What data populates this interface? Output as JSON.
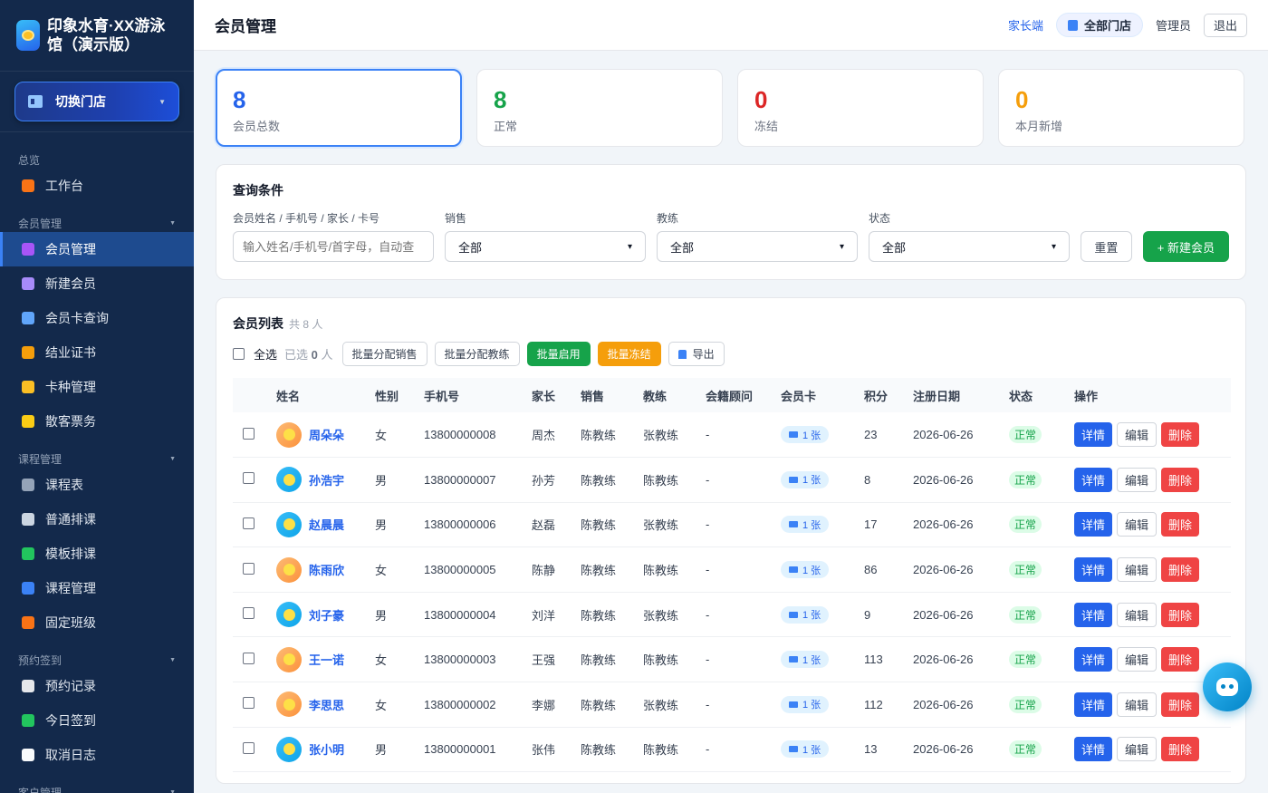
{
  "brand": {
    "title": "印象水育·XX游泳馆（演示版）",
    "logo_icon": "swim-logo-icon"
  },
  "sidebar": {
    "switch_store_label": "切换门店",
    "groups": [
      {
        "label": "总览",
        "items": [
          {
            "label": "工作台",
            "icon": "home-icon",
            "color": "#f97316"
          }
        ]
      },
      {
        "label": "会员管理",
        "items": [
          {
            "label": "会员管理",
            "icon": "users-icon",
            "color": "#a855f7",
            "active": true
          },
          {
            "label": "新建会员",
            "icon": "plus-icon",
            "color": "#a78bfa"
          },
          {
            "label": "会员卡查询",
            "icon": "card-icon",
            "color": "#60a5fa"
          },
          {
            "label": "结业证书",
            "icon": "medal-icon",
            "color": "#f59e0b"
          },
          {
            "label": "卡种管理",
            "icon": "folder-icon",
            "color": "#fbbf24"
          },
          {
            "label": "散客票务",
            "icon": "ticket-icon",
            "color": "#facc15"
          }
        ]
      },
      {
        "label": "课程管理",
        "items": [
          {
            "label": "课程表",
            "icon": "calendar-icon",
            "color": "#94a3b8"
          },
          {
            "label": "普通排课",
            "icon": "calendar-icon",
            "color": "#cbd5e1"
          },
          {
            "label": "模板排课",
            "icon": "template-icon",
            "color": "#22c55e"
          },
          {
            "label": "课程管理",
            "icon": "swim-icon",
            "color": "#3b82f6"
          },
          {
            "label": "固定班级",
            "icon": "school-icon",
            "color": "#f97316"
          }
        ]
      },
      {
        "label": "预约签到",
        "items": [
          {
            "label": "预约记录",
            "icon": "clipboard-icon",
            "color": "#e5e7eb"
          },
          {
            "label": "今日签到",
            "icon": "check-icon",
            "color": "#22c55e"
          },
          {
            "label": "取消日志",
            "icon": "document-icon",
            "color": "#f8fafc"
          }
        ]
      },
      {
        "label": "客户管理",
        "items": []
      }
    ]
  },
  "header": {
    "title": "会员管理",
    "parent_link": "家长端",
    "store": "全部门店",
    "user": "管理员",
    "logout": "退出"
  },
  "stats": [
    {
      "value": "8",
      "label": "会员总数",
      "color": "#2563eb"
    },
    {
      "value": "8",
      "label": "正常",
      "color": "#16a34a"
    },
    {
      "value": "0",
      "label": "冻结",
      "color": "#dc2626"
    },
    {
      "value": "0",
      "label": "本月新增",
      "color": "#f59e0b"
    }
  ],
  "query": {
    "title": "查询条件",
    "keyword_label": "会员姓名 / 手机号 / 家长 / 卡号",
    "keyword_placeholder": "输入姓名/手机号/首字母，自动查",
    "sales_label": "销售",
    "sales_value": "全部",
    "coach_label": "教练",
    "coach_value": "全部",
    "status_label": "状态",
    "status_value": "全部",
    "reset": "重置",
    "new_member": "+ 新建会员"
  },
  "list": {
    "title": "会员列表",
    "count": "共 8 人",
    "select_all": "全选",
    "selected_prefix": "已选",
    "selected_count": "0",
    "selected_suffix": "人",
    "batch_sales": "批量分配销售",
    "batch_coach": "批量分配教练",
    "batch_enable": "批量启用",
    "batch_freeze": "批量冻结",
    "export": "导出",
    "columns": [
      "姓名",
      "性别",
      "手机号",
      "家长",
      "销售",
      "教练",
      "会籍顾问",
      "会员卡",
      "积分",
      "注册日期",
      "状态",
      "操作"
    ],
    "op_detail": "详情",
    "op_edit": "编辑",
    "op_delete": "删除",
    "rows": [
      {
        "name": "周朵朵",
        "gender": "女",
        "phone": "13800000008",
        "parent": "周杰",
        "sales": "陈教练",
        "coach": "张教练",
        "advisor": "-",
        "card": "1 张",
        "points": "23",
        "date": "2026-06-26",
        "status": "正常"
      },
      {
        "name": "孙浩宇",
        "gender": "男",
        "phone": "13800000007",
        "parent": "孙芳",
        "sales": "陈教练",
        "coach": "陈教练",
        "advisor": "-",
        "card": "1 张",
        "points": "8",
        "date": "2026-06-26",
        "status": "正常"
      },
      {
        "name": "赵晨晨",
        "gender": "男",
        "phone": "13800000006",
        "parent": "赵磊",
        "sales": "陈教练",
        "coach": "张教练",
        "advisor": "-",
        "card": "1 张",
        "points": "17",
        "date": "2026-06-26",
        "status": "正常"
      },
      {
        "name": "陈雨欣",
        "gender": "女",
        "phone": "13800000005",
        "parent": "陈静",
        "sales": "陈教练",
        "coach": "陈教练",
        "advisor": "-",
        "card": "1 张",
        "points": "86",
        "date": "2026-06-26",
        "status": "正常"
      },
      {
        "name": "刘子豪",
        "gender": "男",
        "phone": "13800000004",
        "parent": "刘洋",
        "sales": "陈教练",
        "coach": "张教练",
        "advisor": "-",
        "card": "1 张",
        "points": "9",
        "date": "2026-06-26",
        "status": "正常"
      },
      {
        "name": "王一诺",
        "gender": "女",
        "phone": "13800000003",
        "parent": "王强",
        "sales": "陈教练",
        "coach": "陈教练",
        "advisor": "-",
        "card": "1 张",
        "points": "113",
        "date": "2026-06-26",
        "status": "正常"
      },
      {
        "name": "李思思",
        "gender": "女",
        "phone": "13800000002",
        "parent": "李娜",
        "sales": "陈教练",
        "coach": "张教练",
        "advisor": "-",
        "card": "1 张",
        "points": "112",
        "date": "2026-06-26",
        "status": "正常"
      },
      {
        "name": "张小明",
        "gender": "男",
        "phone": "13800000001",
        "parent": "张伟",
        "sales": "陈教练",
        "coach": "陈教练",
        "advisor": "-",
        "card": "1 张",
        "points": "13",
        "date": "2026-06-26",
        "status": "正常"
      }
    ]
  },
  "assistant": {
    "icon": "robot-icon"
  }
}
